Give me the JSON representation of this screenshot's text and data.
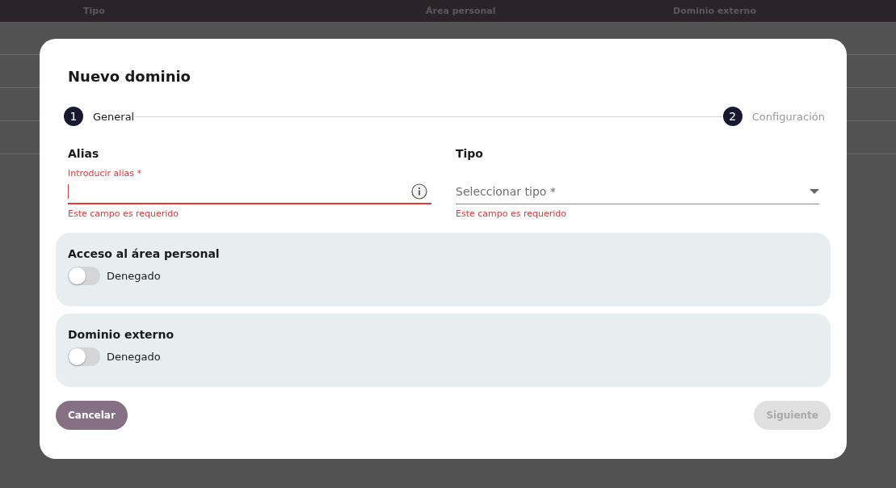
{
  "background_table": {
    "columns": [
      "Tipo",
      "Área personal",
      "Dominio externo"
    ]
  },
  "dialog": {
    "title": "Nuevo dominio",
    "steps": [
      {
        "number": "1",
        "label": "General",
        "selected": true
      },
      {
        "number": "2",
        "label": "Configuración",
        "selected": false
      }
    ],
    "fields": [
      {
        "kind": "text",
        "label": "Alias",
        "floating_label": "Introducir alias *",
        "focused": true,
        "error": "Este campo es requerido"
      },
      {
        "kind": "select",
        "label": "Tipo",
        "placeholder": "Seleccionar tipo *",
        "focused": false,
        "error": "Este campo es requerido"
      }
    ],
    "sections": [
      {
        "title": "Acceso al área personal",
        "toggle": {
          "on": false,
          "label": "Denegado"
        }
      },
      {
        "title": "Dominio externo",
        "toggle": {
          "on": false,
          "label": "Denegado"
        }
      }
    ],
    "buttons": [
      {
        "kind": "secondary",
        "label": "Cancelar",
        "disabled": false
      },
      {
        "kind": "primary",
        "label": "Siguiente",
        "disabled": true
      }
    ]
  }
}
